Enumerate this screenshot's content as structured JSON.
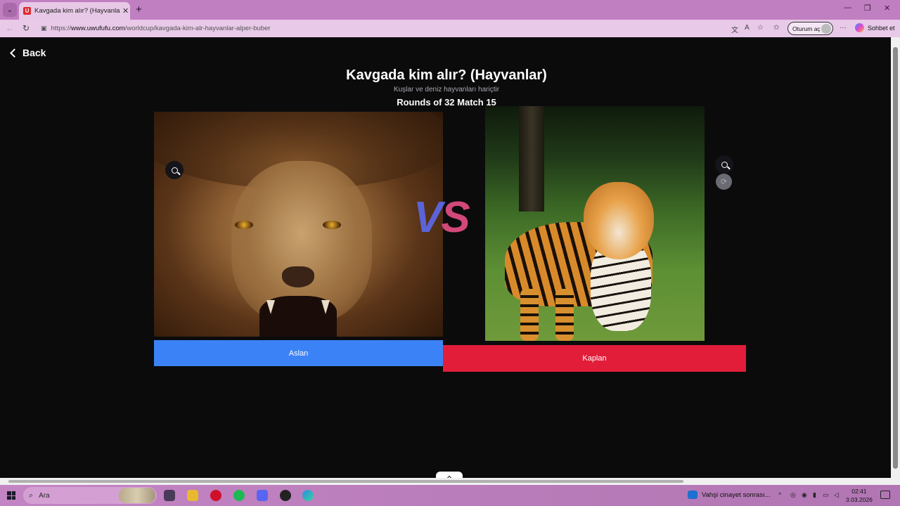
{
  "browser": {
    "tab_title": "Kavgada kim alır? (Hayvanlar) | Uw",
    "favicon_letter": "U",
    "url_prefix": "https://",
    "url_host": "www.uwufufu.com",
    "url_path": "/worldcup/kavgada-kim-alr-hayvanlar-alper-buber",
    "signin_label": "Oturum aç",
    "copilot_label": "Sohbet et",
    "new_tab_glyph": "+",
    "close_glyph": "✕"
  },
  "page": {
    "back_label": "Back",
    "title": "Kavgada kim alır? (Hayvanlar)",
    "subtitle": "Kuşlar ve deniz hayvanları hariçtir",
    "round_info": "Rounds of 32 Match 15",
    "vs_v": "V",
    "vs_s": "S",
    "left_choice": "Aslan",
    "right_choice": "Kaplan"
  },
  "taskbar": {
    "search_placeholder": "Ara",
    "weather_text": "Vahşi cinayet sonrası...",
    "time": "02:41",
    "date": "3.03.2026"
  },
  "colors": {
    "left_button": "#3b82f6",
    "right_button": "#e11d3a",
    "vs_v": "#5b63d8",
    "vs_s": "#d3487a"
  }
}
